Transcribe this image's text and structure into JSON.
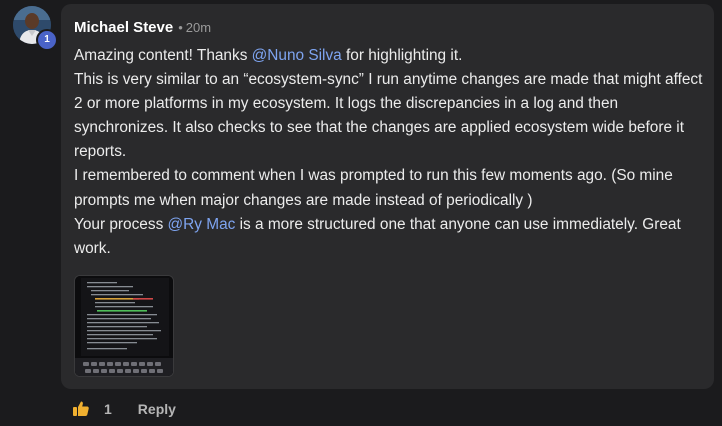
{
  "comment": {
    "author": "Michael Steve",
    "separator": "•",
    "time": "20m",
    "avatar_badge": "1",
    "paragraphs": [
      {
        "segments": [
          {
            "text": "Amazing content! Thanks ",
            "mention": false
          },
          {
            "text": "@Nuno Silva",
            "mention": true
          },
          {
            "text": " for highlighting it.",
            "mention": false
          }
        ]
      },
      {
        "segments": [
          {
            "text": "This is very similar to an “ecosystem-sync” I run anytime changes are made that might affect 2 or more platforms in my ecosystem. It logs the discrepancies in a log and then synchronizes. It also checks to see that the changes are applied ecosystem wide before it reports.",
            "mention": false
          }
        ]
      },
      {
        "segments": [
          {
            "text": "I remembered to comment when I was prompted to run this few moments ago. (So mine prompts me when major changes are made instead of periodically )",
            "mention": false
          }
        ]
      },
      {
        "segments": [
          {
            "text": "Your process ",
            "mention": false
          },
          {
            "text": "@Ry Mac",
            "mention": true
          },
          {
            "text": " is a more structured one that anyone can use immediately. Great work.",
            "mention": false
          }
        ]
      }
    ]
  },
  "actions": {
    "like_count": "1",
    "reply_label": "Reply"
  },
  "icons": {
    "like": "thumbs-up-icon"
  },
  "colors": {
    "background": "#1b1b1d",
    "bubble": "#2a2a2c",
    "mention": "#7ea4f0",
    "badge": "#4a63c8",
    "like": "#f0b030"
  }
}
